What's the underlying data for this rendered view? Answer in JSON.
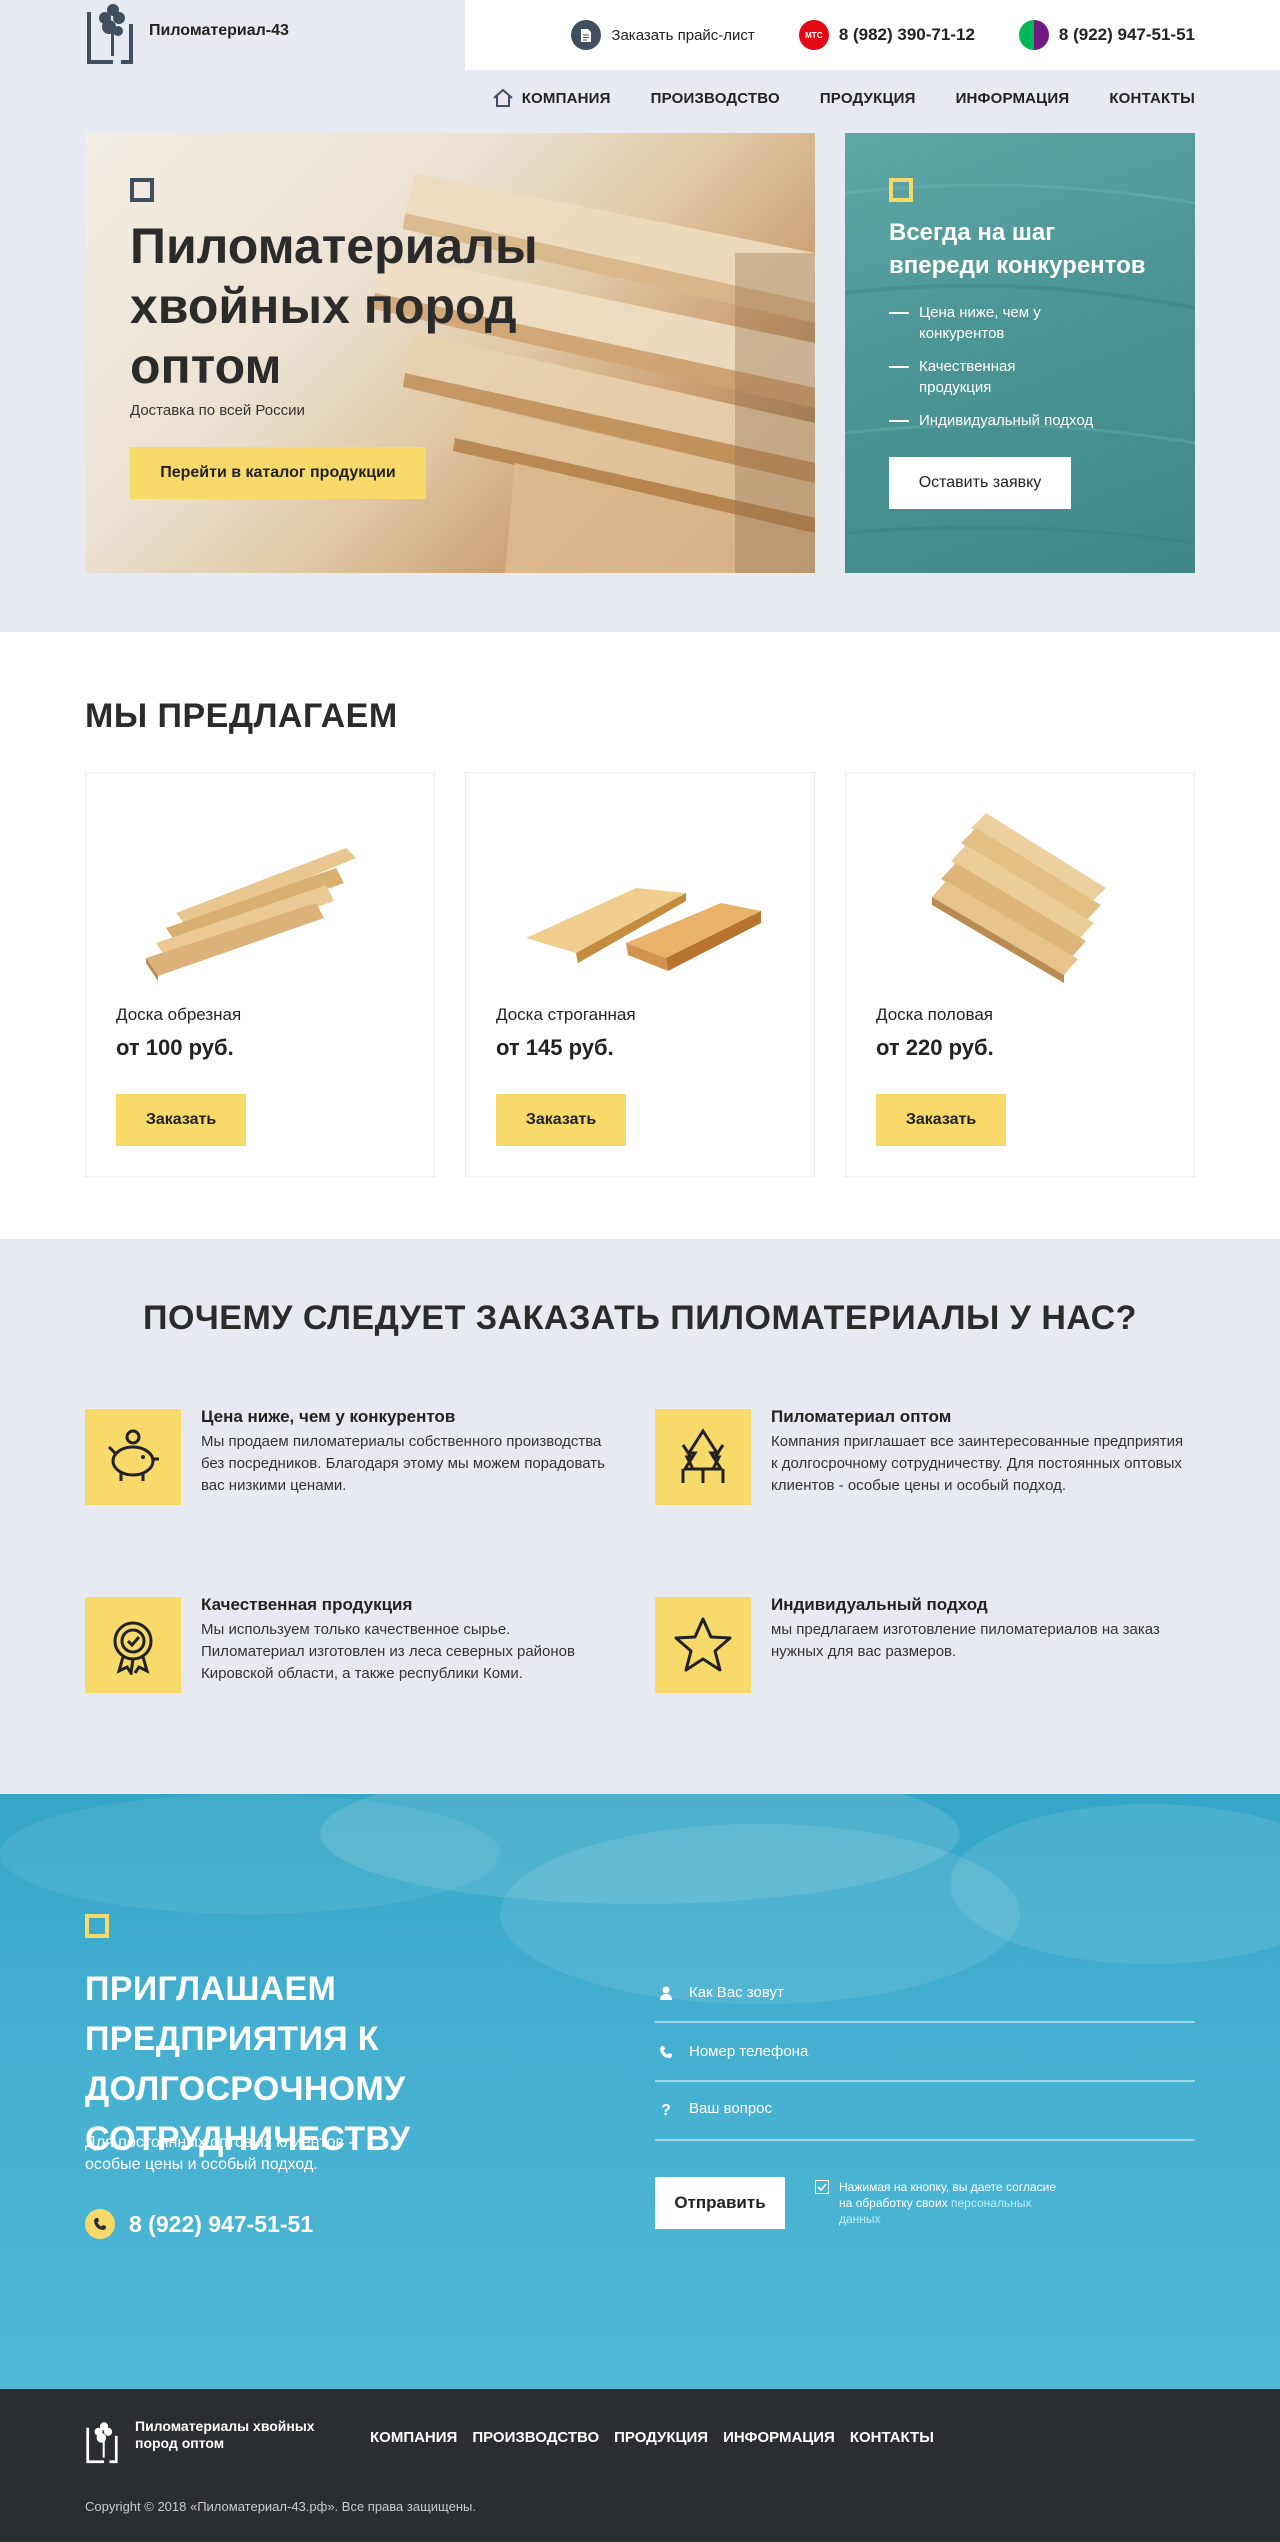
{
  "header": {
    "logo_text": "Пиломатериал-43",
    "price_list": "Заказать прайс-лист",
    "mts_badge": "МТС",
    "phone1": "8 (982) 390-71-12",
    "phone2": "8 (922) 947-51-51"
  },
  "nav": {
    "items": [
      "КОМПАНИЯ",
      "ПРОИЗВОДСТВО",
      "ПРОДУКЦИЯ",
      "ИНФОРМАЦИЯ",
      "КОНТАКТЫ"
    ]
  },
  "hero": {
    "title": "Пиломатериалы хвойных пород оптом",
    "subtitle": "Доставка по всей России",
    "button": "Перейти в каталог продукции"
  },
  "hero_side": {
    "title": "Всегда на шаг впереди конкурентов",
    "points": [
      "Цена ниже, чем у конкурентов",
      "Качественная продукция",
      "Индивидуальный подход"
    ],
    "button": "Оставить заявку"
  },
  "offers": {
    "title": "МЫ ПРЕДЛАГАЕМ",
    "items": [
      {
        "name": "Доска обрезная",
        "price": "от 100 руб.",
        "button": "Заказать"
      },
      {
        "name": "Доска строганная",
        "price": "от 145 руб.",
        "button": "Заказать"
      },
      {
        "name": "Доска половая",
        "price": "от 220 руб.",
        "button": "Заказать"
      }
    ]
  },
  "why": {
    "title": "ПОЧЕМУ СЛЕДУЕТ ЗАКАЗАТЬ ПИЛОМАТЕРИАЛЫ У НАС?",
    "items": [
      {
        "icon": "piggy-bank-icon",
        "title": "Цена ниже, чем у конкурентов",
        "text": "Мы продаем пиломатериалы собственного производства без посредников. Благодаря этому мы можем порадовать вас низкими ценами."
      },
      {
        "icon": "trees-icon",
        "title": "Пиломатериал оптом",
        "text": "Компания приглашает все заинтересованные предприятия к долгосрочному сотрудничеству. Для постоянных оптовых клиентов - особые цены и особый подход."
      },
      {
        "icon": "quality-badge-icon",
        "title": "Качественная продукция",
        "text": "Мы используем только качественное сырье. Пиломатериал изготовлен из леса северных районов Кировской области, а также республики Коми."
      },
      {
        "icon": "star-icon",
        "title": "Индивидуальный подход",
        "text": "мы предлагаем изготовление пиломатериалов на заказ нужных для вас размеров."
      }
    ]
  },
  "coop": {
    "title": "ПРИГЛАШАЕМ ПРЕДПРИЯТИЯ К ДОЛГОСРОЧНОМУ СОТРУДНИЧЕСТВУ",
    "subtitle": "Для постоянных оптовых клиентов - особые цены и особый подход.",
    "phone": "8 (922) 947-51-51",
    "form": {
      "name_placeholder": "Как Вас зовут",
      "phone_placeholder": "Номер телефона",
      "question_placeholder": "Ваш вопрос",
      "submit": "Отправить",
      "consent_text": "Нажимая на кнопку, вы даете согласие на обработку своих",
      "consent_link": "персональных данных"
    }
  },
  "footer": {
    "logo_text": "Пиломатериалы хвойных пород оптом",
    "nav": [
      "КОМПАНИЯ",
      "ПРОИЗВОДСТВО",
      "ПРОДУКЦИЯ",
      "ИНФОРМАЦИЯ",
      "КОНТАКТЫ"
    ],
    "copyright": "Copyright © 2018 «Пиломатериал-43.рф». Все права защищены."
  },
  "colors": {
    "accent_yellow": "#f8da6b",
    "dark": "#3f4f5d",
    "teal_panel": "#4c9597",
    "sky_blue": "#44afd0",
    "footer_bg": "#2b2e31"
  }
}
